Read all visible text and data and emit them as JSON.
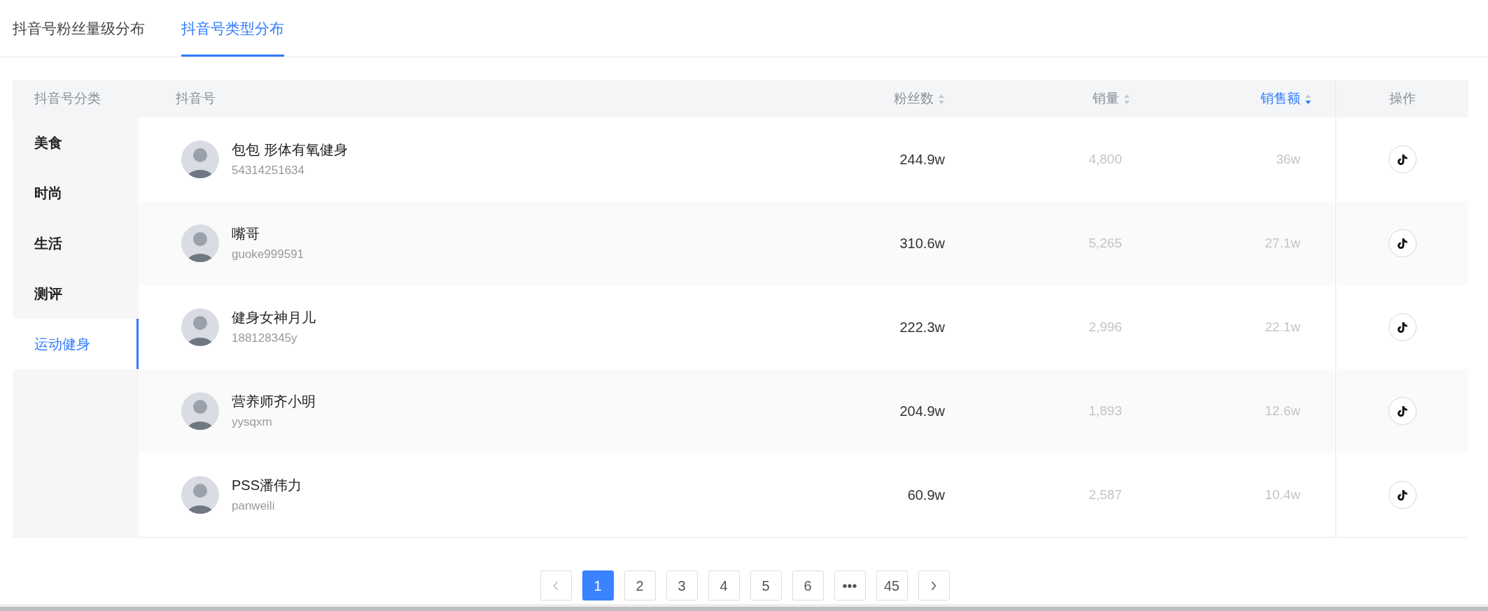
{
  "tabs": [
    {
      "label": "抖音号粉丝量级分布",
      "selected": false
    },
    {
      "label": "抖音号类型分布",
      "selected": true
    }
  ],
  "categories": {
    "header": "抖音号分类",
    "items": [
      {
        "label": "美食",
        "selected": false
      },
      {
        "label": "时尚",
        "selected": false
      },
      {
        "label": "生活",
        "selected": false
      },
      {
        "label": "测评",
        "selected": false
      },
      {
        "label": "运动健身",
        "selected": true
      }
    ]
  },
  "table": {
    "columns": [
      {
        "label": "抖音号",
        "sortable": false,
        "sorted": false
      },
      {
        "label": "粉丝数",
        "sortable": true,
        "sorted": false
      },
      {
        "label": "销量",
        "sortable": true,
        "sorted": false
      },
      {
        "label": "销售额",
        "sortable": true,
        "sorted": true
      },
      {
        "label": "操作",
        "sortable": false,
        "sorted": false
      }
    ],
    "rows": [
      {
        "name": "包包 形体有氧健身",
        "id": "54314251634",
        "fans": "244.9w",
        "sales": "4,800",
        "revenue": "36w"
      },
      {
        "name": "嘴哥",
        "id": "guoke999591",
        "fans": "310.6w",
        "sales": "5,265",
        "revenue": "27.1w"
      },
      {
        "name": "健身女神月儿",
        "id": "188128345y",
        "fans": "222.3w",
        "sales": "2,996",
        "revenue": "22.1w"
      },
      {
        "name": "营养师齐小明",
        "id": "yysqxm",
        "fans": "204.9w",
        "sales": "1,893",
        "revenue": "12.6w"
      },
      {
        "name": "PSS潘伟力",
        "id": "panweili",
        "fans": "60.9w",
        "sales": "2,587",
        "revenue": "10.4w"
      }
    ]
  },
  "pagination": {
    "pages": [
      {
        "label": "1",
        "selected": true
      },
      {
        "label": "2",
        "selected": false
      },
      {
        "label": "3",
        "selected": false
      },
      {
        "label": "4",
        "selected": false
      },
      {
        "label": "5",
        "selected": false
      },
      {
        "label": "6",
        "selected": false
      },
      {
        "label": "•••",
        "selected": false
      },
      {
        "label": "45",
        "selected": false
      }
    ]
  }
}
